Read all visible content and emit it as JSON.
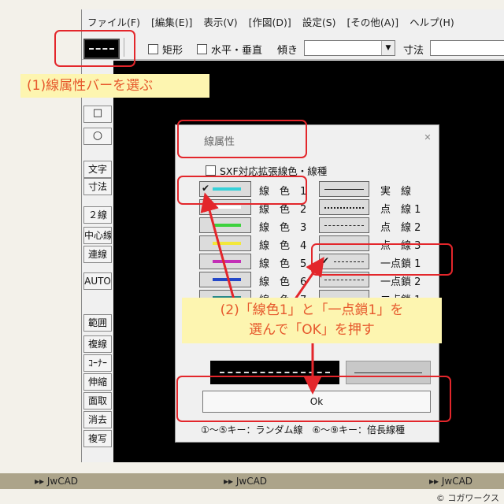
{
  "menubar": {
    "items": [
      "ファイル(F)",
      "[編集(E)]",
      "表示(V)",
      "[作図(D)]",
      "設定(S)",
      "[その他(A)]",
      "ヘルプ(H)"
    ]
  },
  "toolbar": {
    "rectangle_label": "矩形",
    "horizontal_vertical_label": "水平・垂直",
    "tilt_label": "傾き",
    "tilt_value": "",
    "dimension_label": "寸法",
    "dimension_value": ""
  },
  "left_toolbar": {
    "buttons": [
      "文字",
      "寸法",
      "２線",
      "中心線",
      "連線",
      "AUTO",
      "範囲",
      "複線",
      "ｺｰﾅｰ",
      "伸縮",
      "面取",
      "消去",
      "複写"
    ]
  },
  "dialog": {
    "title": "線属性",
    "close_icon": "close-icon",
    "sxf_label": "SXF対応拡張線色・線種",
    "line_colors": [
      {
        "label": "線　色　1",
        "color": "#36d0d8",
        "selected": true
      },
      {
        "label": "線　色　2",
        "color": "#ffffff",
        "selected": false
      },
      {
        "label": "線　色　3",
        "color": "#3ed23e",
        "selected": false
      },
      {
        "label": "線　色　4",
        "color": "#f3e83a",
        "selected": false
      },
      {
        "label": "線　色　5",
        "color": "#c32fb6",
        "selected": false
      },
      {
        "label": "線　色　6",
        "color": "#2448c8",
        "selected": false
      },
      {
        "label": "線　色　7",
        "color": "#2a8a8a",
        "selected": false
      }
    ],
    "line_types": [
      {
        "label": "実　線",
        "pattern": "solid",
        "selected": false
      },
      {
        "label": "点　線 1",
        "pattern": "dotted",
        "selected": false
      },
      {
        "label": "点　線 2",
        "pattern": "dashed",
        "selected": false
      },
      {
        "label": "点　線 3",
        "pattern": "dashed",
        "selected": false
      },
      {
        "label": "一点鎖 1",
        "pattern": "dashed",
        "selected": true
      },
      {
        "label": "一点鎖 2",
        "pattern": "dashed",
        "selected": false
      },
      {
        "label": "二点鎖 1",
        "pattern": "dashed",
        "selected": false
      }
    ],
    "ok_label": "Ok",
    "hint": "①～⑤キー：ランダム線　⑥～⑨キー：倍長線種"
  },
  "annotations": {
    "step1": "(1)線属性バーを選ぶ",
    "step2_line1": "(2)「線色1」と「一点鎖1」を",
    "step2_line2": "選んで「OK」を押す",
    "accent_color": "#e3262b",
    "callout_bg": "#fdf5b0",
    "callout_text": "#e6582c"
  },
  "footer": {
    "labels": [
      "▸▸ JwCAD",
      "▸▸ JwCAD",
      "▸▸ JwCAD"
    ],
    "copyright": "© コガワークス"
  }
}
